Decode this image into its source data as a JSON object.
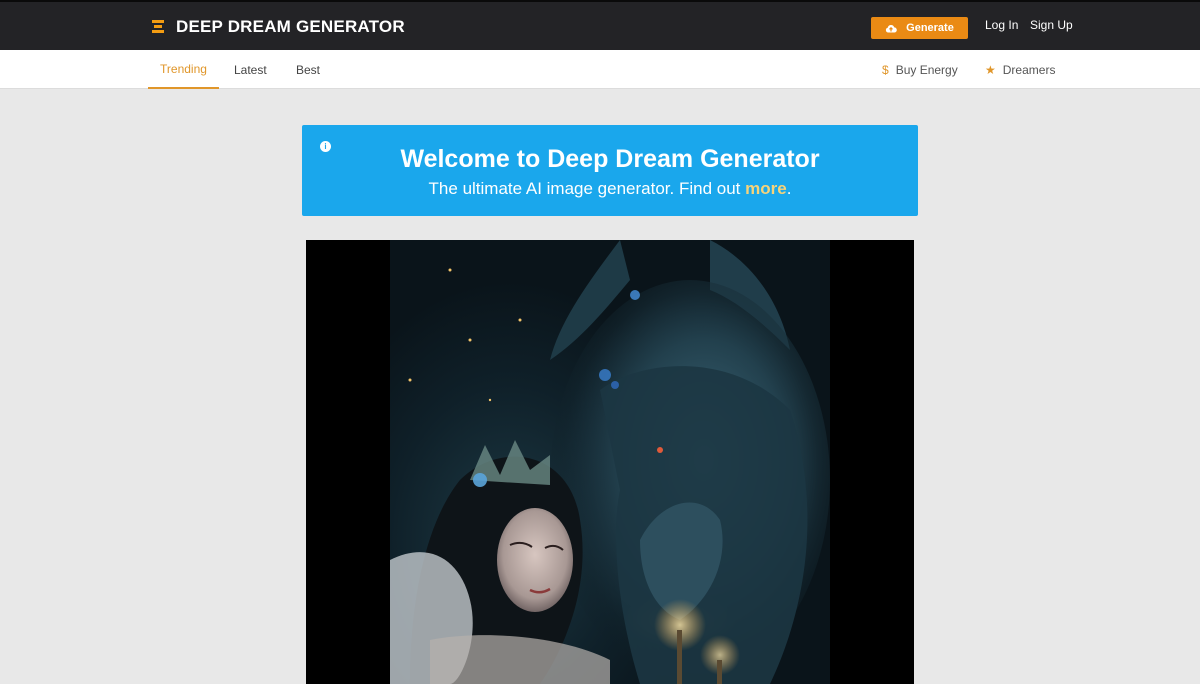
{
  "header": {
    "brand": "DEEP DREAM GENERATOR",
    "generate_label": "Generate",
    "login_label": "Log In",
    "signup_label": "Sign Up"
  },
  "tabs": [
    {
      "label": "Trending",
      "active": true
    },
    {
      "label": "Latest",
      "active": false
    },
    {
      "label": "Best",
      "active": false
    }
  ],
  "right_links": {
    "buy_energy": "Buy Energy",
    "dreamers": "Dreamers"
  },
  "banner": {
    "title": "Welcome to Deep Dream Generator",
    "subtitle_prefix": "The ultimate AI image generator. Find out ",
    "subtitle_link": "more",
    "subtitle_suffix": "."
  },
  "colors": {
    "accent": "#ea8a14",
    "banner": "#1aa7ec",
    "topbar": "#232326"
  },
  "icons": {
    "brand": "logo-icon",
    "generate": "cloud-upload-icon",
    "buy_energy": "dollar-icon",
    "dreamers": "star-icon",
    "banner": "info-icon"
  }
}
